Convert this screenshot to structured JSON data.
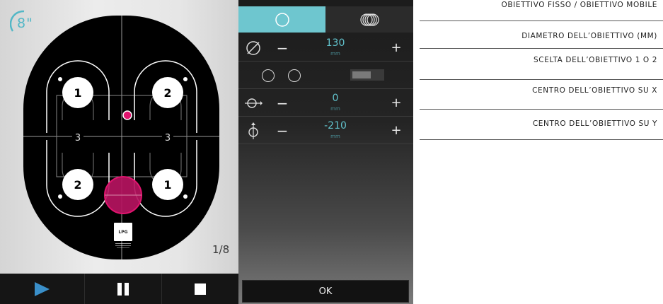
{
  "device": {
    "program_label": "8\"",
    "page_counter": "1/8",
    "logo_text": "LPG",
    "map_zones": [
      {
        "label": "1"
      },
      {
        "label": "2"
      },
      {
        "label": "2"
      },
      {
        "label": "1"
      },
      {
        "label": "3"
      },
      {
        "label": "3"
      }
    ],
    "colors": {
      "accent": "#53b7c6",
      "target": "#e0146e",
      "zone_bg": "#000000"
    }
  },
  "player": {
    "play_icon": "play-icon",
    "pause_icon": "pause-icon",
    "stop_icon": "stop-icon"
  },
  "settings": {
    "tabs": [
      {
        "icon": "single-circle-icon",
        "selected": true
      },
      {
        "icon": "stacked-circles-icon",
        "selected": false
      }
    ],
    "diameter": {
      "icon": "diameter-icon",
      "minus": "−",
      "value": "130",
      "unit": "mm",
      "plus": "+"
    },
    "lens_choice": {
      "icon_1": "circle-outline-icon",
      "icon_2": "circle-outline-icon"
    },
    "center_x": {
      "icon": "center-x-icon",
      "minus": "−",
      "value": "0",
      "unit": "mm",
      "plus": "+"
    },
    "center_y": {
      "icon": "center-y-icon",
      "minus": "−",
      "value": "-210",
      "unit": "mm",
      "plus": "+"
    },
    "ok_label": "OK"
  },
  "annotations": [
    "OBIETTIVO FISSO / OBIETTIVO MOBILE",
    "DIAMETRO DELL’OBIETTIVO (MM)",
    "SCELTA DELL’OBIETTIVO 1 O 2",
    "CENTRO DELL’OBIETTIVO SU X",
    "CENTRO DELL’OBIETTIVO SU Y"
  ]
}
